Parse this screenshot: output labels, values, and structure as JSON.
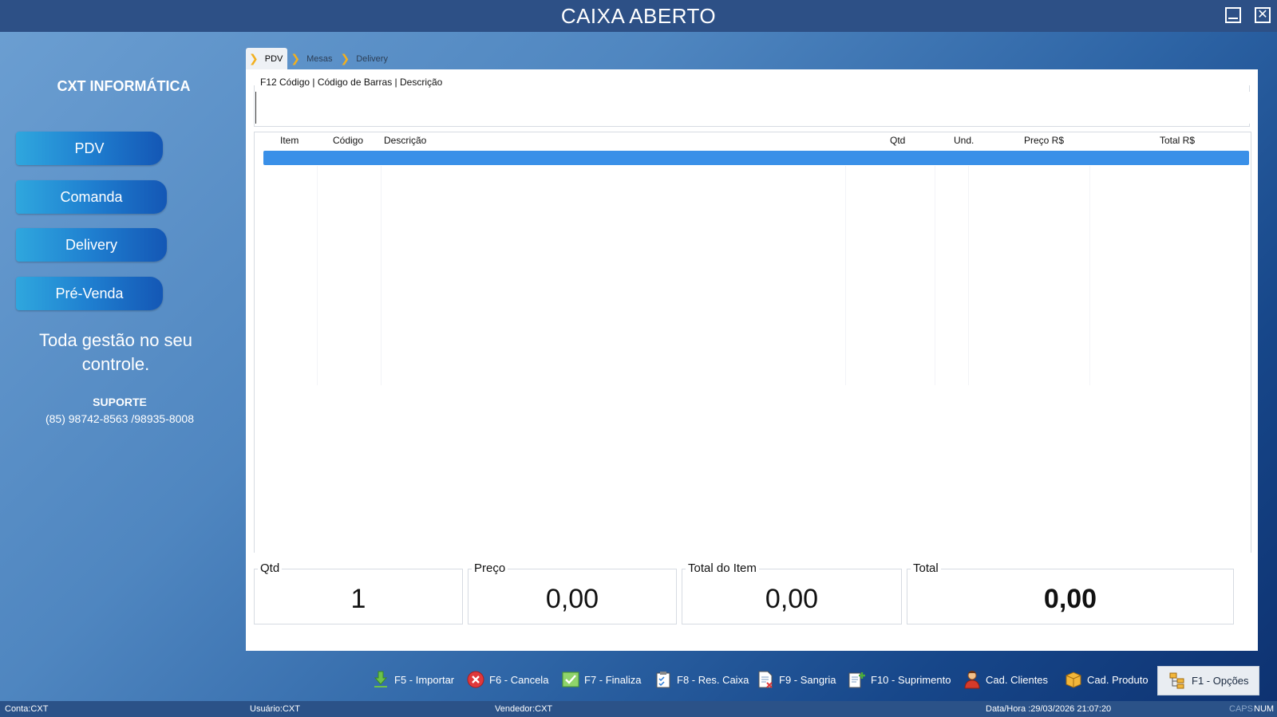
{
  "window": {
    "title": "CAIXA ABERTO"
  },
  "sidebar": {
    "brand": "CXT INFORMÁTICA",
    "buttons": [
      "PDV",
      "Comanda",
      "Delivery",
      "Pré-Venda"
    ],
    "slogan": "Toda gestão  no seu controle.",
    "support_title": "SUPORTE",
    "support_phone": "(85) 98742-8563  /98935-8008"
  },
  "breadcrumb": [
    "PDV",
    "Mesas",
    "Delivery"
  ],
  "search": {
    "label": "F12  Código | Código de Barras | Descrição",
    "value": ""
  },
  "grid": {
    "columns": [
      "Item",
      "Código",
      "Descrição",
      "Qtd",
      "Und.",
      "Preço R$",
      "Total R$"
    ],
    "rows": []
  },
  "totals": {
    "qtd_label": "Qtd",
    "qtd_value": "1",
    "preco_label": "Preço",
    "preco_value": "0,00",
    "total_item_label": "Total do Item",
    "total_item_value": "0,00",
    "total_label": "Total",
    "total_value": "0,00"
  },
  "toolbar": {
    "importar": "F5 - Importar",
    "cancela": "F6 - Cancela",
    "finaliza": "F7 - Finaliza",
    "res_caixa": "F8 - Res. Caixa",
    "sangria": "F9 - Sangria",
    "suprimento": "F10 - Suprimento",
    "cad_clientes": "Cad. Clientes",
    "cad_produto": "Cad. Produto",
    "opcoes": "F1 - Opções"
  },
  "status": {
    "conta": "Conta:CXT",
    "usuario": "Usuário:CXT",
    "vendedor": "Vendedor:CXT",
    "datahora": "Data/Hora :29/03/2026 21:07:20",
    "caps": "CAPS",
    "num": "NUM"
  },
  "colors": {
    "titlebar": "#2d5086",
    "selected_row": "#3a90e8",
    "accent_chevron": "#f2b01e"
  }
}
